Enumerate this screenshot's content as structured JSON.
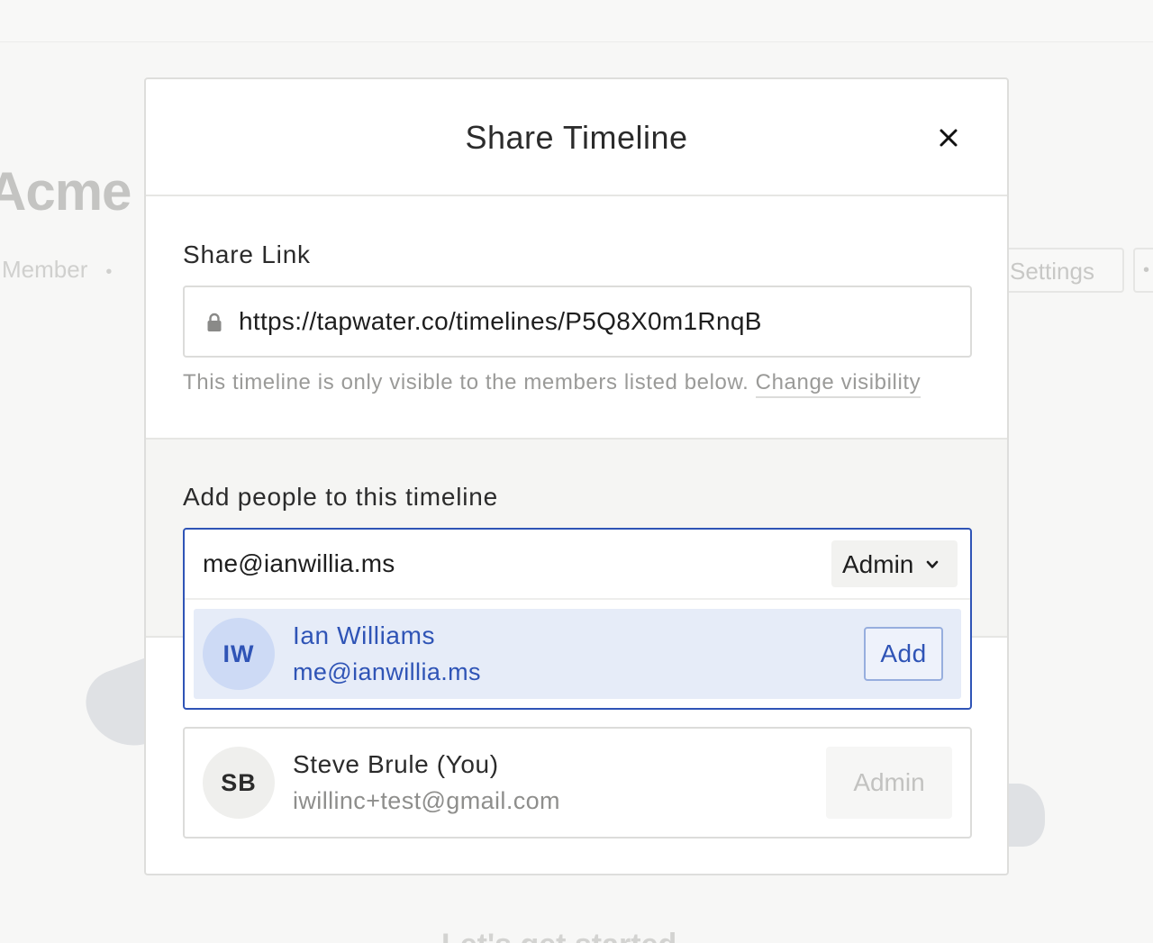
{
  "background": {
    "title": "Acme I",
    "meta_role": "Member",
    "meta_separator": "•",
    "settings_label": "Settings",
    "more_label": "•",
    "bottom_text": "Let's get started"
  },
  "modal": {
    "title": "Share Timeline",
    "close_icon": "close-icon"
  },
  "share_link": {
    "label": "Share Link",
    "url": "https://tapwater.co/timelines/P5Q8X0m1RnqB",
    "lock_icon": "lock-icon",
    "visibility_note": "This timeline is only visible to the members listed below.",
    "change_visibility_label": "Change visibility"
  },
  "add_people": {
    "label": "Add people to this timeline",
    "input_value": "me@ianwillia.ms",
    "role_selected": "Admin",
    "suggestion": {
      "initials": "IW",
      "name": "Ian Williams",
      "email": "me@ianwillia.ms",
      "add_label": "Add"
    }
  },
  "members": [
    {
      "initials": "SB",
      "name": "Steve Brule (You)",
      "email": "iwillinc+test@gmail.com",
      "role": "Admin"
    }
  ],
  "colors": {
    "accent": "#2f54b6",
    "suggestion_bg": "#e6ecf8",
    "section_bg": "#f5f5f3"
  }
}
